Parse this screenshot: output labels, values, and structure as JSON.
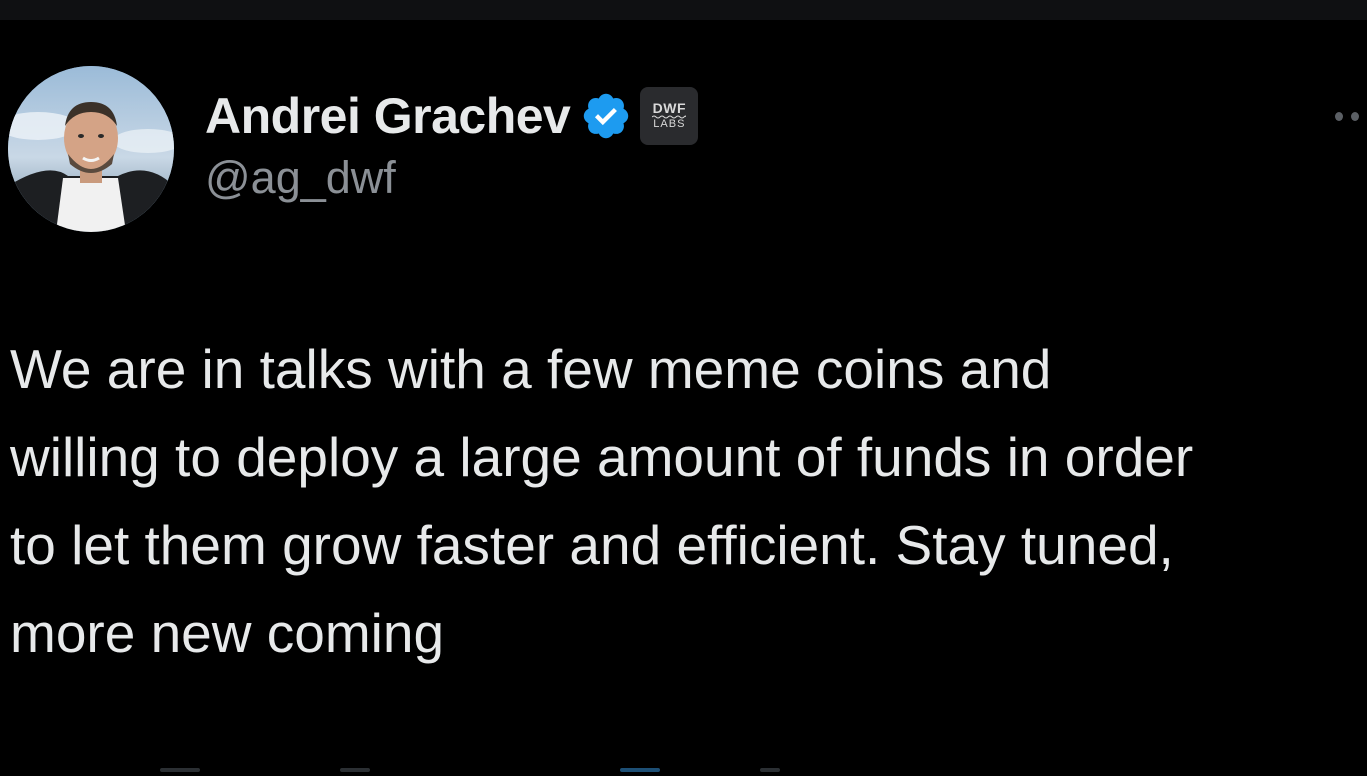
{
  "tweet": {
    "author": {
      "display_name": "Andrei Grachev",
      "handle": "@ag_dwf",
      "verified": true,
      "verified_color": "#1d9bf0",
      "affiliate_badge": {
        "top_text": "DWF",
        "bottom_text": "LABS"
      }
    },
    "text": "We are in talks with a few meme coins and\nwilling to deploy a large amount of funds in order\nto let them grow faster and efficient. Stay tuned,\nmore new coming",
    "more_icon": "more-horizontal-icon"
  },
  "theme": {
    "background": "#000000",
    "text": "#e7e9ea",
    "muted": "#8b9096"
  }
}
